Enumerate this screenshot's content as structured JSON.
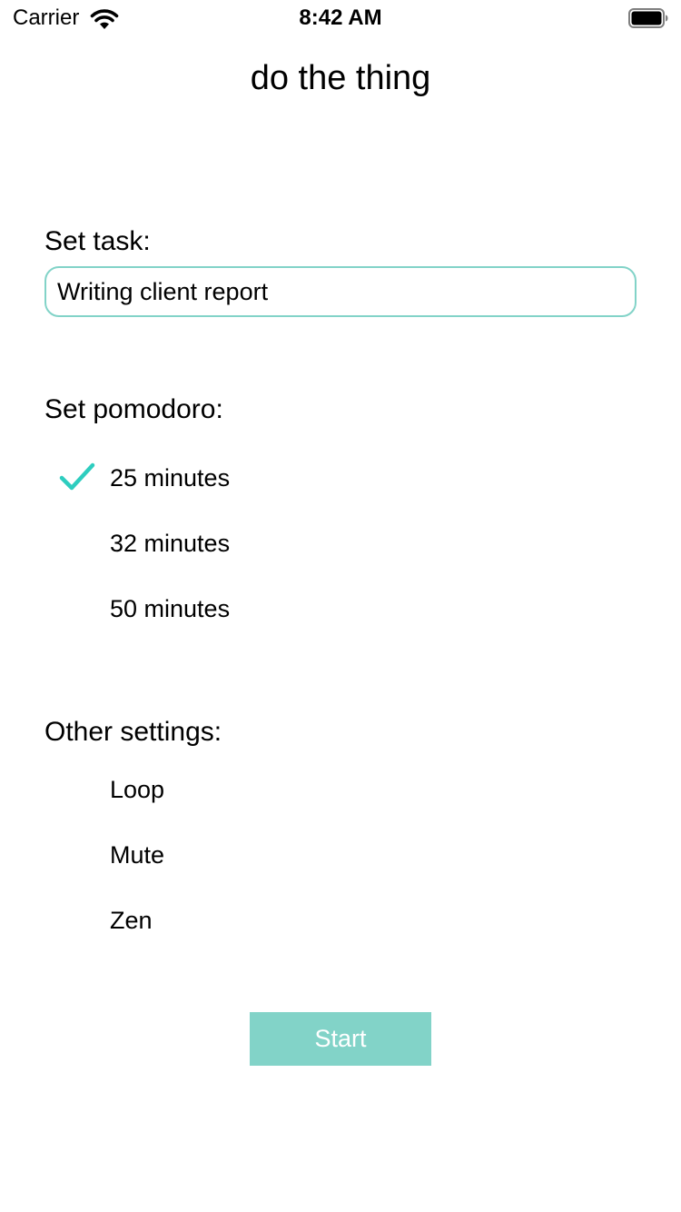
{
  "status_bar": {
    "carrier": "Carrier",
    "time": "8:42 AM",
    "wifi_icon": "wifi-icon",
    "battery_icon": "battery-icon"
  },
  "app": {
    "title": "do the thing"
  },
  "task": {
    "label": "Set task:",
    "value": "Writing client report"
  },
  "pomodoro": {
    "label": "Set pomodoro:",
    "options": [
      {
        "label": "25 minutes",
        "selected": true
      },
      {
        "label": "32 minutes",
        "selected": false
      },
      {
        "label": "50 minutes",
        "selected": false
      }
    ]
  },
  "other_settings": {
    "label": "Other settings:",
    "options": [
      {
        "label": "Loop",
        "selected": false
      },
      {
        "label": "Mute",
        "selected": false
      },
      {
        "label": "Zen",
        "selected": false
      }
    ]
  },
  "start_button": {
    "label": "Start"
  },
  "colors": {
    "accent": "#82d3c8",
    "checkmark": "#2ecdbf",
    "text": "#000000",
    "background": "#ffffff"
  }
}
